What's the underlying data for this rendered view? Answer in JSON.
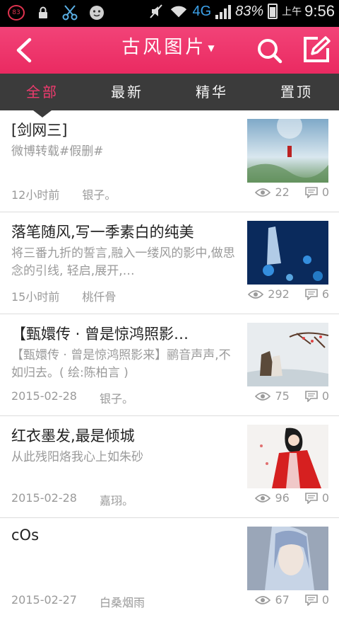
{
  "status_bar": {
    "notification_badge": "83",
    "network": "4G",
    "battery_percent": "83%",
    "ampm": "上午",
    "time": "9:56"
  },
  "header": {
    "title": "古风图片",
    "back_icon": "back-arrow-icon",
    "search_icon": "search-icon",
    "edit_icon": "edit-icon",
    "accent_color": "#ef3b6e"
  },
  "tabs": [
    {
      "label": "全部",
      "active": true
    },
    {
      "label": "最新",
      "active": false
    },
    {
      "label": "精华",
      "active": false
    },
    {
      "label": "置顶",
      "active": false
    }
  ],
  "posts": [
    {
      "title": "[剑网三]",
      "summary": "微博转载#假删#",
      "time": "12小时前",
      "author": "银子。",
      "views": "22",
      "comments": "0"
    },
    {
      "title": "落笔随风,写一季素白的纯美",
      "summary": "将三番九折的誓言,融入一缕风的影中,做思念的引线, 轻启,展开,…",
      "time": "15小时前",
      "author": "桃仟骨",
      "views": "292",
      "comments": "6"
    },
    {
      "title": "【甄嬛传 · 曾是惊鸿照影…",
      "summary": "【甄嬛传 · 曾是惊鸿照影来】鹂音声声,不如归去。( 绘:陈柏言 )",
      "time": "2015-02-28",
      "author": "银子。",
      "views": "75",
      "comments": "0"
    },
    {
      "title": "红衣墨发,最是倾城",
      "summary": "从此残阳烙我心上如朱砂",
      "time": "2015-02-28",
      "author": "嘉珝。",
      "views": "96",
      "comments": "0"
    },
    {
      "title": "cOs",
      "summary": "",
      "time": "2015-02-27",
      "author": "白桑烟雨",
      "views": "67",
      "comments": "0"
    }
  ]
}
